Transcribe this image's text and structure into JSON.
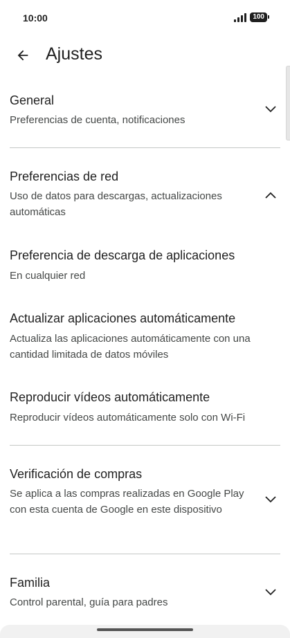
{
  "status_bar": {
    "time": "10:00",
    "battery": "100"
  },
  "header": {
    "title": "Ajustes"
  },
  "sections": {
    "general": {
      "title": "General",
      "subtitle": "Preferencias de cuenta, notificaciones",
      "expanded": false
    },
    "network": {
      "title": "Preferencias de red",
      "subtitle": "Uso de datos para descargas, actualizaciones automáticas",
      "expanded": true,
      "items": [
        {
          "title": "Preferencia de descarga de aplicaciones",
          "subtitle": "En cualquier red"
        },
        {
          "title": "Actualizar aplicaciones automáticamente",
          "subtitle": "Actualiza las aplicaciones automáticamente con una cantidad limitada de datos móviles"
        },
        {
          "title": "Reproducir vídeos automáticamente",
          "subtitle": "Reproducir vídeos automáticamente solo con Wi-Fi"
        }
      ]
    },
    "purchase": {
      "title": "Verificación de compras",
      "subtitle": "Se aplica a las compras realizadas en Google Play con esta cuenta de Google en este dispositivo",
      "expanded": false
    },
    "family": {
      "title": "Familia",
      "subtitle": "Control parental, guía para padres",
      "expanded": false
    }
  },
  "icons": {
    "back": "arrow-back-icon",
    "expand": "chevron-down-icon",
    "collapse": "chevron-up-icon",
    "signal": "signal-icon",
    "battery": "battery-icon"
  }
}
